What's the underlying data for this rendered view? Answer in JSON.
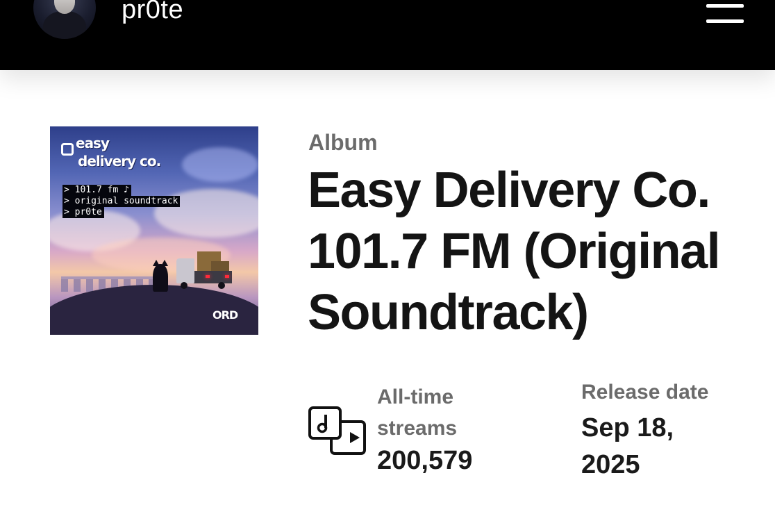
{
  "header": {
    "artist_name": "pr0te",
    "avatar_icon": "artist-avatar",
    "menu_icon": "hamburger-menu-icon"
  },
  "cover": {
    "logo_line1": "easy",
    "logo_line2": "delivery co.",
    "terminal_lines": [
      "> 101.7 fm ♪",
      "> original soundtrack",
      "> pr0te"
    ],
    "badge": "ORD"
  },
  "album": {
    "type": "Album",
    "title": "Easy Delivery Co. 101.7 FM (Original Soundtrack)"
  },
  "stats": {
    "streams_label": "All-time streams",
    "streams_value": "200,579",
    "streams_icon": "music-streams-icon",
    "release_label": "Release date",
    "release_value": "Sep 18, 2025"
  }
}
